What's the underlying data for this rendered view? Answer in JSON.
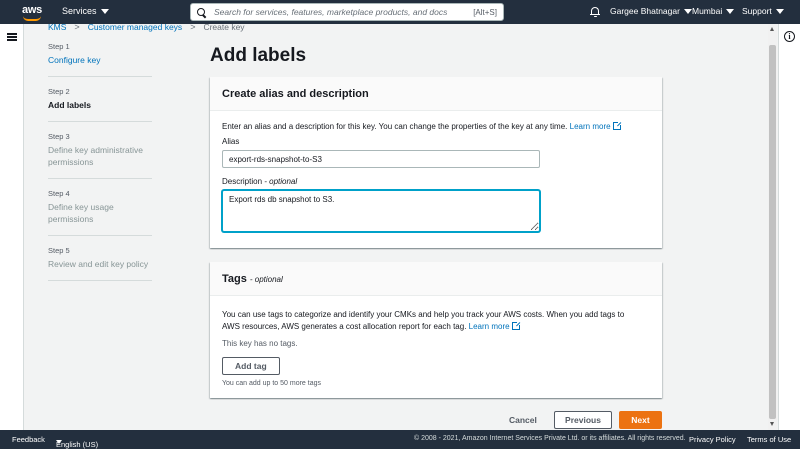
{
  "topnav": {
    "logo_text": "aws",
    "services_label": "Services",
    "search_placeholder": "Search for services, features, marketplace products, and docs",
    "search_shortcut": "[Alt+S]",
    "user": "Gargee Bhatnagar",
    "region": "Mumbai",
    "support": "Support"
  },
  "breadcrumb": {
    "items": [
      "KMS",
      "Customer managed keys",
      "Create key"
    ],
    "separator": ">"
  },
  "steps": [
    {
      "num": "Step 1",
      "title": "Configure key",
      "state": "link"
    },
    {
      "num": "Step 2",
      "title": "Add labels",
      "state": "active"
    },
    {
      "num": "Step 3",
      "title": "Define key administrative permissions",
      "state": "disabled"
    },
    {
      "num": "Step 4",
      "title": "Define key usage permissions",
      "state": "disabled"
    },
    {
      "num": "Step 5",
      "title": "Review and edit key policy",
      "state": "disabled"
    }
  ],
  "page_title": "Add labels",
  "alias_panel": {
    "title": "Create alias and description",
    "intro": "Enter an alias and a description for this key. You can change the properties of the key at any time.",
    "learn_more": "Learn more",
    "alias_label": "Alias",
    "alias_value": "export-rds-snapshot-to-S3",
    "description_label": "Description",
    "description_optional": "- optional",
    "description_value": "Export rds db snapshot to S3."
  },
  "tags_panel": {
    "title": "Tags",
    "optional": "- optional",
    "intro_1": "You can use tags to categorize and identify your CMKs and help you track your AWS costs. When you add tags to",
    "intro_2": "AWS resources, AWS generates a cost allocation report for each tag.",
    "learn_more": "Learn more",
    "no_tags": "This key has no tags.",
    "add_tag_label": "Add tag",
    "limit_note": "You can add up to 50 more tags"
  },
  "actions": {
    "cancel": "Cancel",
    "previous": "Previous",
    "next": "Next"
  },
  "footer": {
    "feedback": "Feedback",
    "language": "English (US)",
    "copyright": "© 2008 - 2021, Amazon Internet Services Private Ltd. or its affiliates. All rights reserved.",
    "privacy": "Privacy Policy",
    "terms": "Terms of Use"
  },
  "colors": {
    "nav_bg": "#232f3e",
    "link": "#0073bb",
    "primary_button": "#ec7211",
    "focus_border": "#00a1c9",
    "page_bg": "#f2f3f3"
  },
  "icons": [
    "aws-logo",
    "search-icon",
    "bell-icon",
    "menu-icon",
    "info-icon",
    "external-link-icon",
    "caret-down-icon"
  ]
}
